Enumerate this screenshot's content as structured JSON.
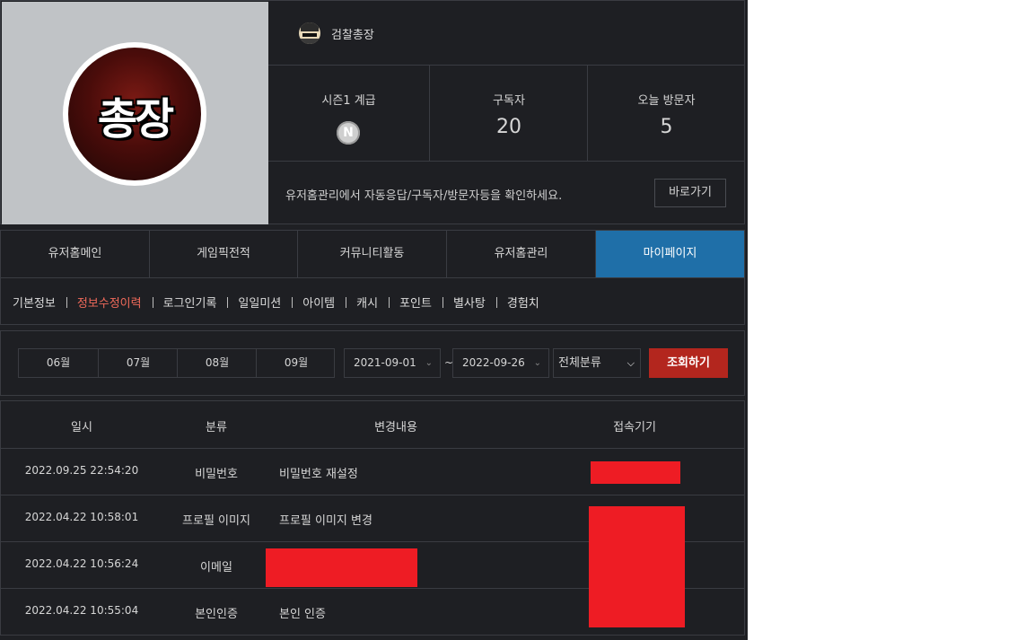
{
  "profile": {
    "avatar_text": "총장",
    "username": "검찰총장",
    "stats": [
      {
        "label": "시즌1 계급",
        "badge": "N"
      },
      {
        "label": "구독자",
        "value": "20"
      },
      {
        "label": "오늘 방문자",
        "value": "5"
      }
    ],
    "notice": "유저홈관리에서 자동응답/구독자/방문자등을 확인하세요.",
    "goto_label": "바로가기"
  },
  "tabs": [
    {
      "label": "유저홈메인",
      "active": false
    },
    {
      "label": "게임픽전적",
      "active": false
    },
    {
      "label": "커뮤니티활동",
      "active": false
    },
    {
      "label": "유저홈관리",
      "active": false
    },
    {
      "label": "마이페이지",
      "active": true
    }
  ],
  "subtabs": [
    {
      "label": "기본정보"
    },
    {
      "label": "정보수정이력",
      "active": true
    },
    {
      "label": "로그인기록"
    },
    {
      "label": "일일미션"
    },
    {
      "label": "아이템"
    },
    {
      "label": "캐시"
    },
    {
      "label": "포인트"
    },
    {
      "label": "별사탕"
    },
    {
      "label": "경험치"
    }
  ],
  "filter": {
    "months": [
      "06월",
      "07월",
      "08월",
      "09월"
    ],
    "date_from": "2021-09-01",
    "separator": "~",
    "date_to": "2022-09-26",
    "category": "전체분류",
    "search_label": "조회하기"
  },
  "table": {
    "headers": [
      "일시",
      "분류",
      "변경내용",
      "접속기기"
    ],
    "rows": [
      {
        "date": "2022.09.25 22:54:20",
        "category": "비밀번호",
        "desc": "비밀번호 재설정"
      },
      {
        "date": "2022.04.22 10:58:01",
        "category": "프로필 이미지",
        "desc": "프로필 이미지 변경"
      },
      {
        "date": "2022.04.22 10:56:24",
        "category": "이메일",
        "desc": ""
      },
      {
        "date": "2022.04.22 10:55:04",
        "category": "본인인증",
        "desc": "본인 인증"
      }
    ]
  },
  "colors": {
    "background": "#1f2024",
    "active_tab": "#1f6fa8",
    "active_subtab": "#f06a5a",
    "search_button": "#b3261e",
    "redaction": "#ee1c24"
  }
}
